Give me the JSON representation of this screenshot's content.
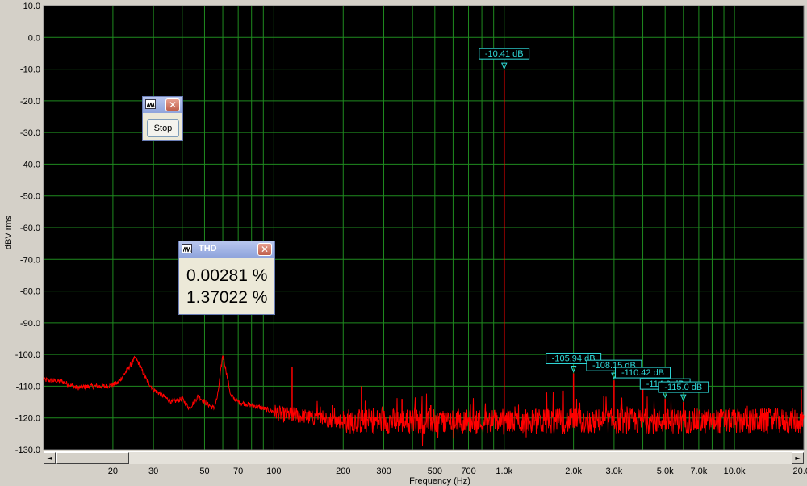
{
  "chart_data": {
    "type": "line",
    "title": "",
    "xlabel": "Frequency (Hz)",
    "ylabel": "dBV rms",
    "xscale": "log",
    "xlim": [
      10,
      20000
    ],
    "ylim": [
      -130,
      10
    ],
    "yticks": [
      10,
      0,
      -10,
      -20,
      -30,
      -40,
      -50,
      -60,
      -70,
      -80,
      -90,
      -100,
      -110,
      -120,
      -130
    ],
    "ytick_labels": [
      "10.0",
      "0.0",
      "-10.0",
      "-20.0",
      "-30.0",
      "-40.0",
      "-50.0",
      "-60.0",
      "-70.0",
      "-80.0",
      "-90.0",
      "-100.0",
      "-110.0",
      "-120.0",
      "-130.0"
    ],
    "xticks": [
      20,
      30,
      50,
      70,
      100,
      200,
      300,
      500,
      700,
      1000,
      2000,
      3000,
      5000,
      7000,
      10000,
      20000
    ],
    "xtick_labels": [
      "20",
      "30",
      "50",
      "70",
      "100",
      "200",
      "300",
      "500",
      "700",
      "1.0k",
      "2.0k",
      "3.0k",
      "5.0k",
      "7.0k",
      "10.0k",
      "20.0k"
    ],
    "grid": true,
    "background": "#000000",
    "grid_color": "#1f8a1f",
    "series": [
      {
        "color": "#ff0000",
        "noise_floor": -121,
        "points": [
          [
            10,
            -108
          ],
          [
            12,
            -108.5
          ],
          [
            14,
            -110.5
          ],
          [
            16,
            -110
          ],
          [
            19,
            -110
          ],
          [
            21,
            -109
          ],
          [
            22,
            -107
          ],
          [
            24,
            -103
          ],
          [
            25,
            -101
          ],
          [
            26,
            -103
          ],
          [
            28,
            -108
          ],
          [
            30,
            -111
          ],
          [
            33,
            -113
          ],
          [
            36,
            -115
          ],
          [
            40,
            -114
          ],
          [
            43,
            -117
          ],
          [
            47,
            -113
          ],
          [
            50,
            -115
          ],
          [
            55,
            -117
          ],
          [
            57,
            -113
          ],
          [
            60,
            -100
          ],
          [
            62,
            -105
          ],
          [
            65,
            -113
          ],
          [
            70,
            -115
          ],
          [
            80,
            -116
          ],
          [
            90,
            -117
          ],
          [
            100,
            -118
          ],
          [
            110,
            -119
          ],
          [
            120,
            -119
          ],
          [
            150,
            -120
          ],
          [
            200,
            -121
          ],
          [
            400,
            -121
          ],
          [
            900,
            -121
          ],
          [
            1000,
            -121
          ],
          [
            20000,
            -121
          ]
        ],
        "spikes": [
          {
            "x": 1000,
            "y": -10.41
          },
          {
            "x": 2000,
            "y": -105.94
          },
          {
            "x": 3000,
            "y": -108.15
          },
          {
            "x": 4000,
            "y": -110.42
          },
          {
            "x": 5000,
            "y": -114.0
          },
          {
            "x": 6000,
            "y": -115.0
          },
          {
            "x": 120,
            "y": -104
          },
          {
            "x": 180,
            "y": -116
          },
          {
            "x": 240,
            "y": -110
          },
          {
            "x": 360,
            "y": -114
          },
          {
            "x": 480,
            "y": -116
          },
          {
            "x": 19500,
            "y": -111
          }
        ]
      }
    ],
    "markers": [
      {
        "x": 1000,
        "y": -10.41,
        "label": "-10.41 dB"
      },
      {
        "x": 2000,
        "y": -105.94,
        "label": "-105.94 dB"
      },
      {
        "x": 3000,
        "y": -108.15,
        "label": "-108.15 dB"
      },
      {
        "x": 4000,
        "y": -110.42,
        "label": "-110.42 dB"
      },
      {
        "x": 5000,
        "y": -114.0,
        "label": "-114.0 dB"
      },
      {
        "x": 6000,
        "y": -115.0,
        "label": "-115.0 dB"
      }
    ]
  },
  "stop_window": {
    "button_label": "Stop"
  },
  "thd_window": {
    "title": "THD",
    "value1": "0.00281 %",
    "value2": "1.37022 %"
  },
  "scrollbar": {
    "left_arrow": "◄",
    "right_arrow": "►"
  },
  "colors": {
    "trace": "#ff0000",
    "marker": "#2fd9d9",
    "grid": "#1f8a1f",
    "plot_bg": "#000000",
    "window_bg": "#d4d0c8"
  }
}
